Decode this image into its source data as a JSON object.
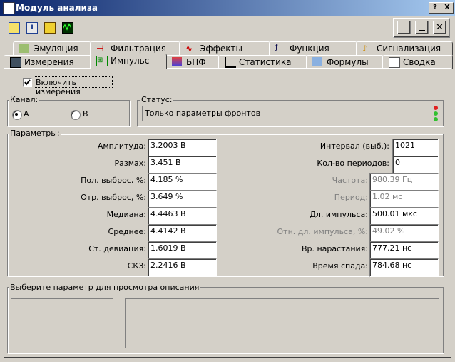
{
  "window": {
    "title": "Модуль анализа",
    "help_label": "?",
    "close_label": "X"
  },
  "toolbar": {
    "icons": [
      "star-icon",
      "info-icon",
      "ruler-icon",
      "scope-icon"
    ],
    "right_icons": [
      "export-icon",
      "minimize-icon",
      "close-icon"
    ]
  },
  "tabs": {
    "row1": [
      {
        "label": "Эмуляция",
        "icon": "emulation-icon"
      },
      {
        "label": "Фильтрация",
        "icon": "filter-icon"
      },
      {
        "label": "Эффекты",
        "icon": "effects-icon"
      },
      {
        "label": "Функция",
        "icon": "function-icon"
      },
      {
        "label": "Сигнализация",
        "icon": "alarm-icon"
      }
    ],
    "row2": [
      {
        "label": "Измерения",
        "icon": "measure-icon"
      },
      {
        "label": "Импульс",
        "icon": "pulse-icon",
        "active": true
      },
      {
        "label": "БПФ",
        "icon": "fft-icon"
      },
      {
        "label": "Статистика",
        "icon": "stats-icon"
      },
      {
        "label": "Формулы",
        "icon": "formula-icon"
      },
      {
        "label": "Сводка",
        "icon": "summary-icon"
      }
    ]
  },
  "enable": {
    "label": "Включить измерения",
    "checked": true
  },
  "channel": {
    "label": "Канал:",
    "a": "A",
    "b": "B",
    "selected": "A"
  },
  "status": {
    "label": "Статус:",
    "value": "Только параметры фронтов"
  },
  "params": {
    "label": "Параметры:",
    "left": [
      {
        "label": "Амплитуда:",
        "value": "3.2003 В"
      },
      {
        "label": "Размах:",
        "value": "3.451 В"
      },
      {
        "label": "Пол. выброс, %:",
        "value": "4.185 %"
      },
      {
        "label": "Отр. выброс, %:",
        "value": "3.649 %"
      },
      {
        "label": "Медиана:",
        "value": "4.4463 В"
      },
      {
        "label": "Среднее:",
        "value": "4.4142 В"
      },
      {
        "label": "Ст. девиация:",
        "value": "1.6019 В"
      },
      {
        "label": "СКЗ:",
        "value": "2.2416 В"
      }
    ],
    "right": [
      {
        "label": "Интервал (выб.):",
        "value": "1021",
        "disabled": false
      },
      {
        "label": "Кол-во периодов:",
        "value": "0",
        "disabled": false
      },
      {
        "label": "Частота:",
        "value": "980.39 Гц",
        "disabled": true
      },
      {
        "label": "Период:",
        "value": "1.02 мс",
        "disabled": true
      },
      {
        "label": "Дл. импульса:",
        "value": "500.01 мкс",
        "disabled": false
      },
      {
        "label": "Отн. дл. импульса, %:",
        "value": "49.02 %",
        "disabled": true
      },
      {
        "label": "Вр. нарастания:",
        "value": "777.21 нс",
        "disabled": false
      },
      {
        "label": "Время спада:",
        "value": "784.68 нс",
        "disabled": false
      }
    ]
  },
  "description": {
    "label": "Выберите параметр для просмотра описания"
  }
}
